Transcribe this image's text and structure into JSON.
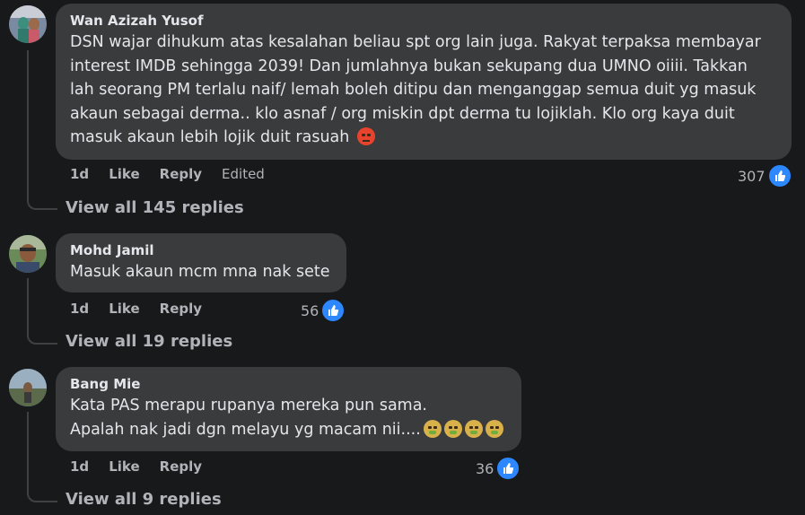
{
  "comments": [
    {
      "author": "Wan Azizah Yusof",
      "lines": [
        "DSN wajar dihukum atas kesalahan beliau spt org lain juga. Rakyat terpaksa membayar",
        "interest IMDB sehingga 2039! Dan jumlahnya bukan sekupang dua UMNO oiiii. Takkan",
        "lah seorang PM terlalu naif/ lemah boleh ditipu dan menganggap semua duit yg masuk",
        "akaun sebagai derma.. klo asnaf / org miskin dpt derma tu lojiklah. Klo org kaya duit",
        "masuk akaun lebih lojik duit rasuah"
      ],
      "emoji": "angry-face-emoji",
      "time": "1d",
      "like_label": "Like",
      "reply_label": "Reply",
      "edited_label": "Edited",
      "like_count": "307",
      "view_replies": "View all 145 replies"
    },
    {
      "author": "Mohd Jamil",
      "lines": [
        "Masuk akaun mcm mna nak sete"
      ],
      "time": "1d",
      "like_label": "Like",
      "reply_label": "Reply",
      "like_count": "56",
      "view_replies": "View all 19 replies"
    },
    {
      "author": "Bang Mie",
      "lines": [
        "Kata PAS merapu rupanya mereka pun sama.",
        "Apalah nak jadi dgn melayu yg macam nii...."
      ],
      "emoji": "nauseated-face-emoji",
      "emoji_count": 4,
      "time": "1d",
      "like_label": "Like",
      "reply_label": "Reply",
      "like_count": "36",
      "view_replies": "View all 9 replies"
    }
  ],
  "icons": {
    "like": "thumbs-up-icon"
  },
  "colors": {
    "background": "#18191a",
    "bubble": "#3a3b3c",
    "like_blue": "#2d88ff",
    "secondary_text": "#b0b3b8"
  }
}
